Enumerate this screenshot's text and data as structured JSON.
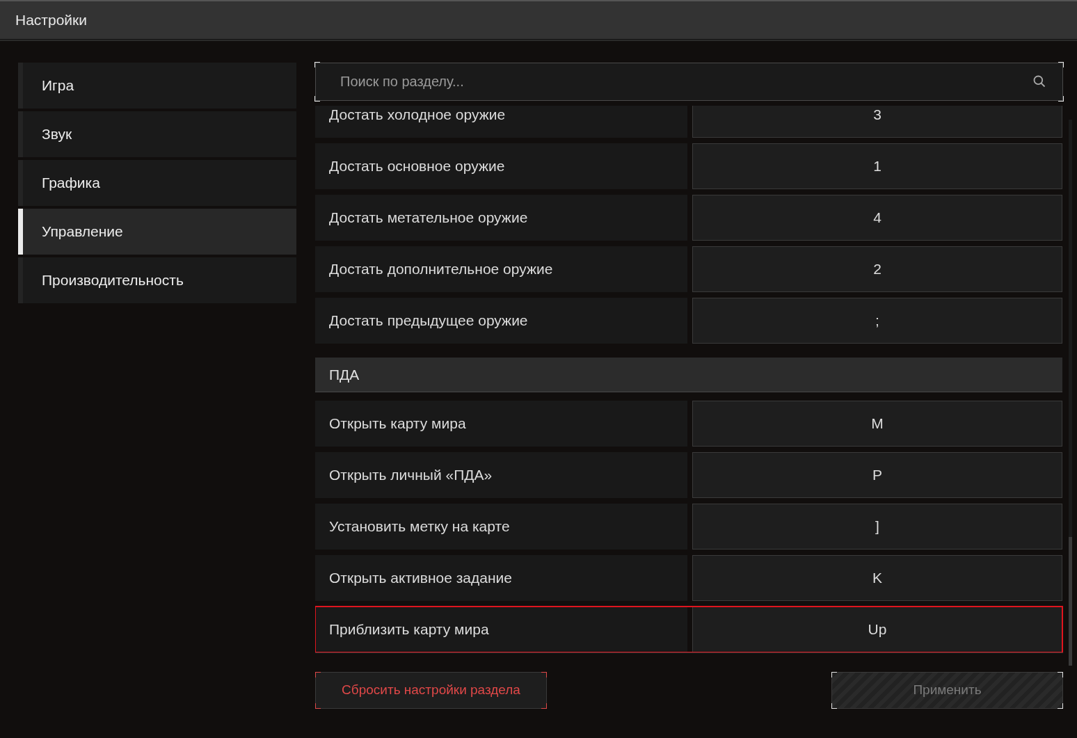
{
  "window": {
    "title": "Настройки"
  },
  "sidebar": {
    "items": [
      {
        "label": "Игра",
        "selected": false
      },
      {
        "label": "Звук",
        "selected": false
      },
      {
        "label": "Графика",
        "selected": false
      },
      {
        "label": "Управление",
        "selected": true
      },
      {
        "label": "Производительность",
        "selected": false
      }
    ]
  },
  "search": {
    "placeholder": "Поиск по разделу..."
  },
  "rows": [
    {
      "kind": "binding",
      "label": "Достать холодное оружие",
      "key": "3",
      "highlighted": false
    },
    {
      "kind": "binding",
      "label": "Достать основное оружие",
      "key": "1",
      "highlighted": false
    },
    {
      "kind": "binding",
      "label": "Достать метательное оружие",
      "key": "4",
      "highlighted": false
    },
    {
      "kind": "binding",
      "label": "Достать дополнительное оружие",
      "key": "2",
      "highlighted": false
    },
    {
      "kind": "binding",
      "label": "Достать предыдущее оружие",
      "key": ";",
      "highlighted": false
    },
    {
      "kind": "section",
      "label": "ПДА"
    },
    {
      "kind": "binding",
      "label": "Открыть карту мира",
      "key": "M",
      "highlighted": false
    },
    {
      "kind": "binding",
      "label": "Открыть личный «ПДА»",
      "key": "P",
      "highlighted": false
    },
    {
      "kind": "binding",
      "label": "Установить метку на карте",
      "key": "]",
      "highlighted": false
    },
    {
      "kind": "binding",
      "label": "Открыть активное задание",
      "key": "K",
      "highlighted": false
    },
    {
      "kind": "binding",
      "label": "Приблизить карту мира",
      "key": "Up",
      "highlighted": true
    }
  ],
  "buttons": {
    "reset": {
      "label": "Сбросить настройки раздела"
    },
    "apply": {
      "label": "Применить",
      "disabled": true
    }
  }
}
